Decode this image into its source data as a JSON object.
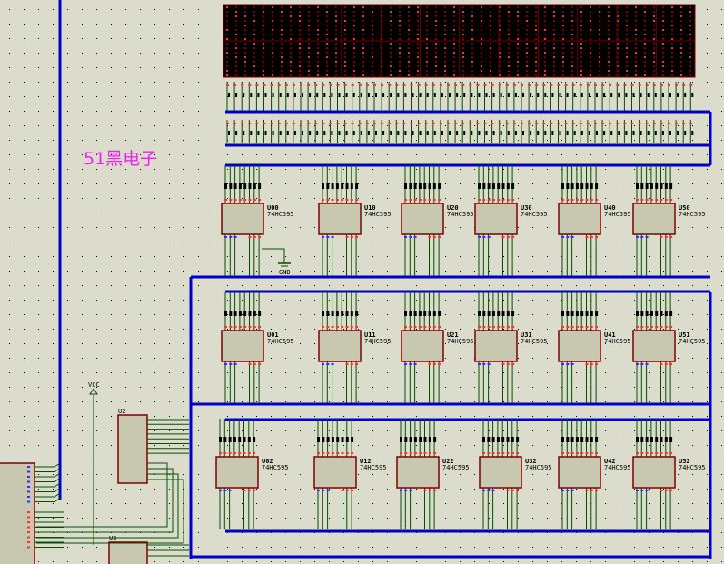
{
  "title_text": "51黑电子",
  "colors": {
    "background": "#dcdccc",
    "bus": "#0000cc",
    "wire": "#005000",
    "chip_fill": "#c8c8b0",
    "chip_border": "#800000",
    "led_on": "#ff3030",
    "led_off": "#800000",
    "matrix_bg": "#000000",
    "title": "#ee22ee"
  },
  "chips": {
    "row1": [
      "U00",
      "U10",
      "U20",
      "U30",
      "U40",
      "U50"
    ],
    "row2": [
      "U01",
      "U11",
      "U21",
      "U31",
      "U41",
      "U51"
    ],
    "row3": [
      "U02",
      "U12",
      "U22",
      "U32",
      "U42",
      "U52"
    ]
  },
  "drivers": [
    "U2",
    "U3"
  ],
  "power": {
    "vcc": "VCC",
    "gnd": "GND"
  }
}
